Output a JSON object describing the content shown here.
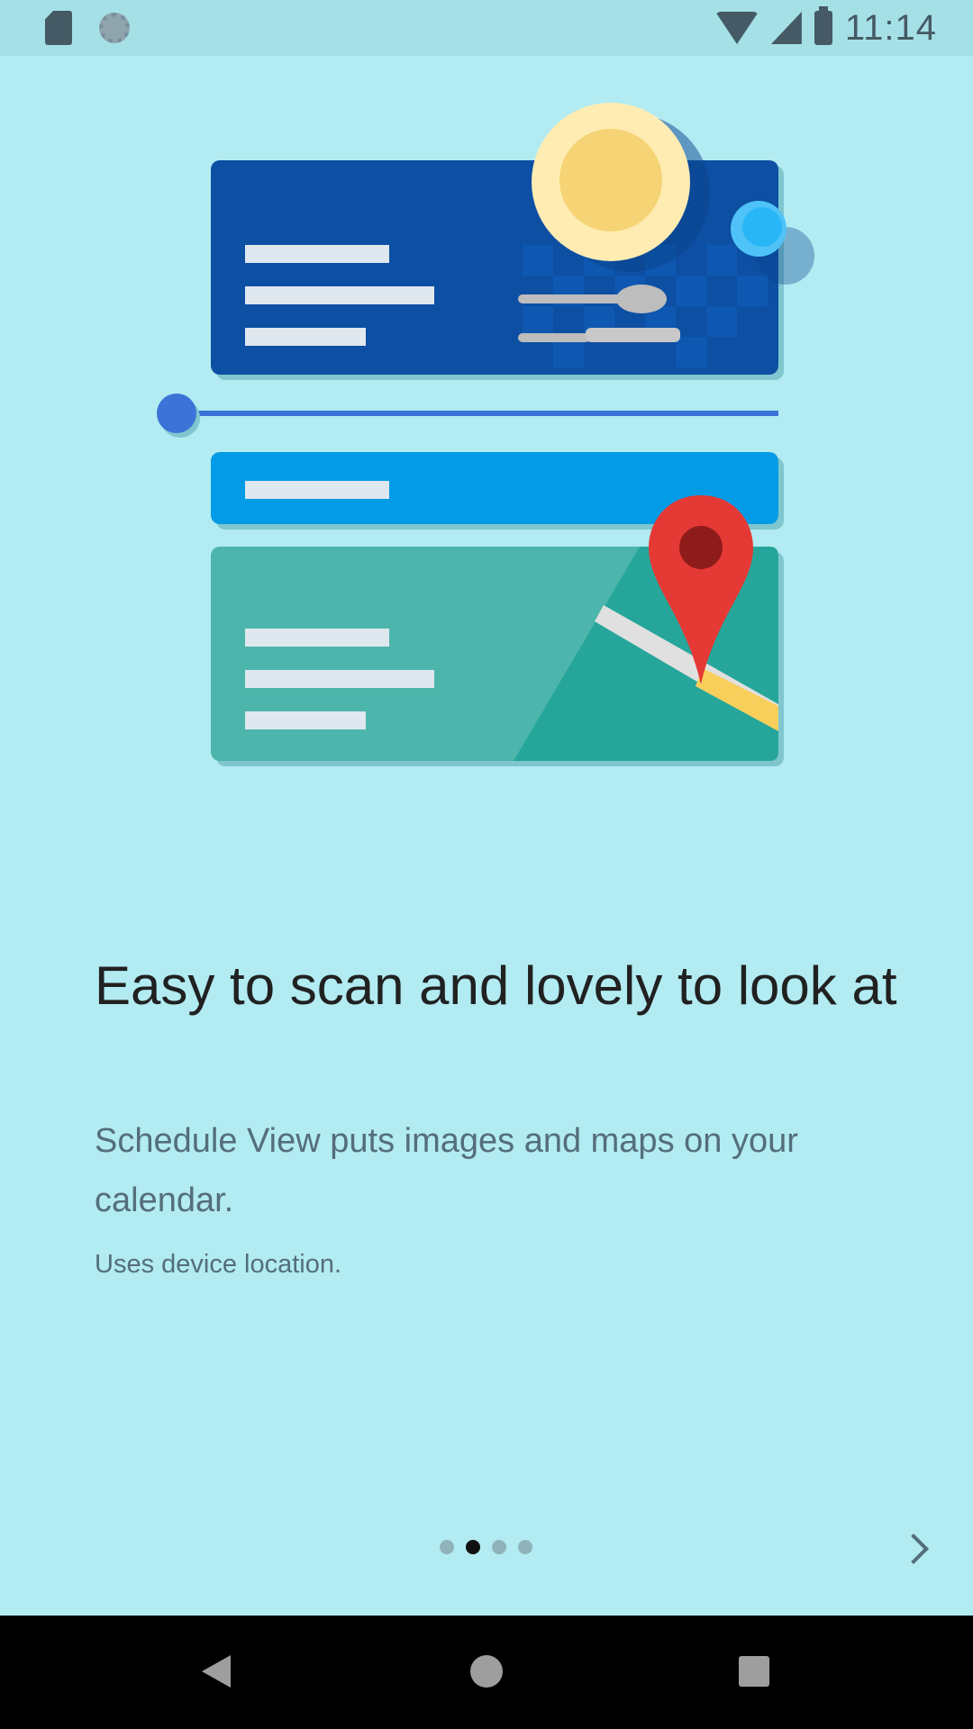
{
  "status_bar": {
    "time": "11:14",
    "left_icons": [
      "sd-card-icon",
      "sync-icon"
    ],
    "right_icons": [
      "wifi-icon",
      "signal-icon",
      "battery-icon"
    ]
  },
  "onboarding": {
    "headline": "Easy to scan and lovely to look at",
    "subtitle": "Schedule View puts images and maps on your calendar.",
    "note": "Uses device location.",
    "page_count": 4,
    "active_page": 2
  },
  "illustration": {
    "icons": [
      "plate-icon",
      "spoon-icon",
      "knife-icon",
      "glass-icon",
      "map-pin-icon",
      "timeline-slider"
    ]
  },
  "navigation": {
    "next_icon": "chevron-right-icon",
    "system_icons": [
      "back-icon",
      "home-icon",
      "recents-icon"
    ]
  },
  "colors": {
    "background": "#b2ebf2",
    "card_dark_blue": "#0d4fa3",
    "card_light_blue": "#039be5",
    "card_teal": "#4db6ac",
    "pin_red": "#e53935"
  }
}
